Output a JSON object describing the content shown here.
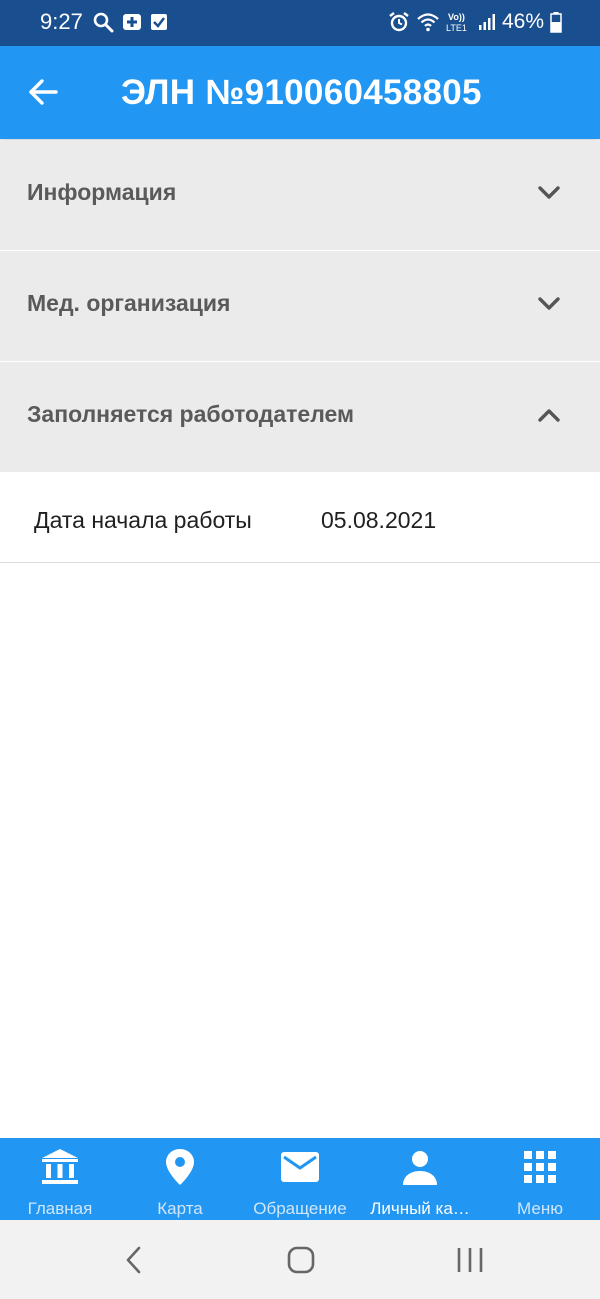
{
  "status_bar": {
    "time": "9:27",
    "battery": "46%",
    "lte_label": "LTE1",
    "volte_label": "Vo))",
    "icons": [
      "search-icon",
      "plus-box-icon",
      "check-box-icon",
      "alarm-icon",
      "wifi-icon",
      "volte-icon",
      "signal-icon",
      "battery-icon"
    ]
  },
  "app_bar": {
    "title": "ЭЛН №910060458805",
    "back_icon": "arrow-left-icon"
  },
  "sections": [
    {
      "label": "Информация",
      "state": "collapsed",
      "icon": "chevron-down-icon"
    },
    {
      "label": "Мед. организация",
      "state": "collapsed",
      "icon": "chevron-down-icon"
    },
    {
      "label": "Заполняется работодателем",
      "state": "expanded",
      "icon": "chevron-up-icon"
    }
  ],
  "employer_fields": [
    {
      "key": "Дата начала работы",
      "value": "05.08.2021"
    }
  ],
  "bottom_nav": {
    "items": [
      {
        "label": "Главная",
        "icon": "bank-icon",
        "active": false
      },
      {
        "label": "Карта",
        "icon": "map-pin-icon",
        "active": false
      },
      {
        "label": "Обращение",
        "icon": "mail-icon",
        "active": false
      },
      {
        "label": "Личный ка…",
        "icon": "person-icon",
        "active": true
      },
      {
        "label": "Меню",
        "icon": "grid-icon",
        "active": false
      }
    ]
  },
  "colors": {
    "status_bar": "#1a4f8f",
    "primary": "#2196f3",
    "section_bg": "#ebebeb",
    "section_text": "#5a5a5a",
    "system_nav": "#f2f2f2"
  },
  "system_nav": [
    "recent-apps-icon",
    "home-icon",
    "back-icon"
  ]
}
